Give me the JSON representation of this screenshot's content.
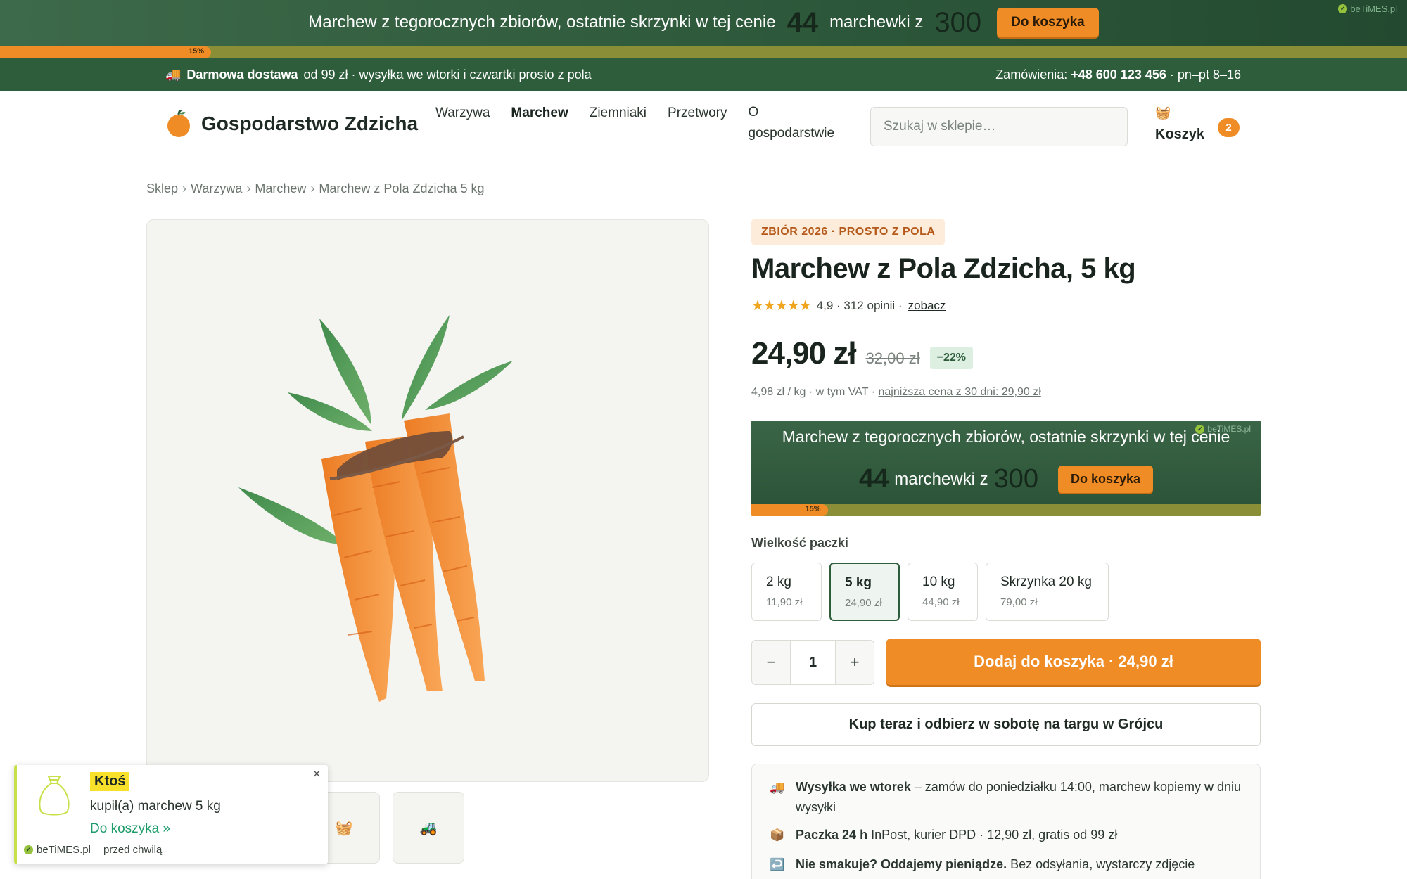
{
  "promo_banner": {
    "text": "Marchew z tegorocznych zbiorów, ostatnie skrzynki w tej cenie",
    "count": "44",
    "unit": "marchewki z",
    "total": "300",
    "button": "Do koszyka",
    "brand": "beTiMES.pl",
    "progress_label": "15%",
    "progress_fraction": 0.15
  },
  "infobar": {
    "icon": "truck-icon",
    "free_shipping": "Darmowa dostawa",
    "shipping_details": "od 99 zł · wysyłka we wtorki i czwartki prosto z pola",
    "orders_label": "Zamówienia:",
    "phone": "+48 600 123 456",
    "hours": "· pn–pt 8–16"
  },
  "header": {
    "logo_text": "Gospodarstwo Zdzicha",
    "nav": [
      "Warzywa",
      "Marchew",
      "Ziemniaki",
      "Przetwory",
      "O gospodarstwie"
    ],
    "active_nav": "Marchew",
    "search_placeholder": "Szukaj w sklepie…",
    "cart_label": "Koszyk",
    "cart_count": "2"
  },
  "breadcrumb": [
    "Sklep",
    "Warzywa",
    "Marchew",
    "Marchew z Pola Zdzicha 5 kg"
  ],
  "product": {
    "badge": "ZBIÓR 2026 · PROSTO Z POLA",
    "title": "Marchew z Pola Zdzicha, 5 kg",
    "stars": "★★★★★",
    "rating": "4,9 · 312 opinii ·",
    "reviews_link": "zobacz",
    "price": "24,90 zł",
    "old_price": "32,00 zł",
    "discount": "−22%",
    "unit_price": "4,98 zł / kg · w tym VAT ·",
    "lowest_price": "najniższa cena z 30 dni: 29,90 zł"
  },
  "inline_widget": {
    "text": "Marchew z tegorocznych zbiorów, ostatnie skrzynki w tej cenie",
    "count": "44",
    "unit": "marchewki z",
    "total": "300",
    "button": "Do koszyka",
    "brand": "beTiMES.pl",
    "progress_label": "15%",
    "progress_fraction": 0.15
  },
  "sizes": {
    "label": "Wielkość paczki",
    "options": [
      {
        "name": "2 kg",
        "price": "11,90 zł"
      },
      {
        "name": "5 kg",
        "price": "24,90 zł",
        "selected": true
      },
      {
        "name": "10 kg",
        "price": "44,90 zł"
      },
      {
        "name": "Skrzynka 20 kg",
        "price": "79,00 zł"
      }
    ]
  },
  "purchase": {
    "minus": "−",
    "quantity": "1",
    "plus": "+",
    "add_button": "Dodaj do koszyka · 24,90 zł",
    "buy_now": "Kup teraz i odbierz w sobotę na targu w Grójcu"
  },
  "shipping": [
    {
      "icon": "truck-icon",
      "bold": "Wysyłka we wtorek",
      "text": "– zamów do poniedziałku 14:00, marchew kopiemy w dniu wysyłki"
    },
    {
      "icon": "package-icon",
      "bold": "Paczka 24 h",
      "text": "InPost, kurier DPD · 12,90 zł, gratis od 99 zł"
    },
    {
      "icon": "return-icon",
      "bold": "Nie smakuje? Oddajemy pieniądze.",
      "text": "Bez odsyłania, wystarczy zdjęcie"
    }
  ],
  "thumbnails": [
    "basket-icon",
    "tractor-icon"
  ],
  "popup": {
    "name": "Ktoś",
    "action": "kupił(a) marchew 5 kg",
    "link": "Do koszyka »",
    "brand": "beTiMES.pl",
    "time": "przed chwilą",
    "close": "×"
  },
  "colors": {
    "accent_orange": "#f08c25",
    "brand_green": "#2e5d3b",
    "banner_green": "#2f5a3c",
    "progress_track": "#8a8f37"
  }
}
